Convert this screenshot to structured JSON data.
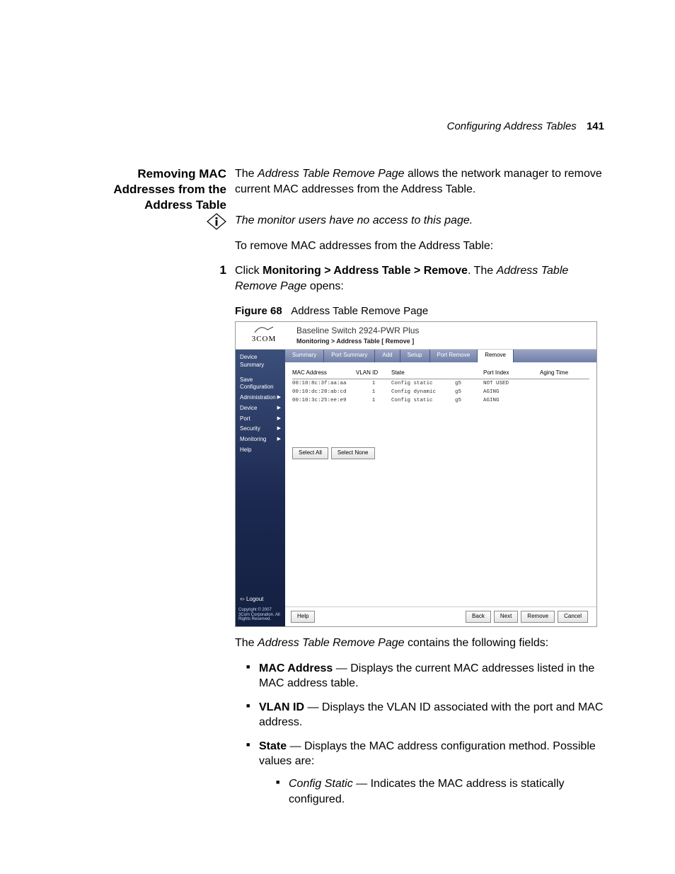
{
  "header": {
    "section": "Configuring Address Tables",
    "page_number": "141"
  },
  "sidehead": "Removing MAC Addresses from the Address Table",
  "intro": {
    "p1_a": "The ",
    "p1_em": "Address Table Remove Page",
    "p1_b": " allows the network manager to remove current MAC addresses from the Address Table.",
    "note": "The monitor users have no access to this page.",
    "p2": "To remove MAC addresses from the Address Table:"
  },
  "step1": {
    "num": "1",
    "a": "Click ",
    "b": "Monitoring > Address Table > Remove",
    "c": ". The ",
    "d": "Address Table Remove Page",
    "e": " opens:"
  },
  "figure": {
    "label": "Figure 68",
    "caption": "Address Table Remove Page"
  },
  "screenshot": {
    "brand": "3COM",
    "product": "Baseline Switch 2924-PWR Plus",
    "breadcrumb": "Monitoring > Address Table [ Remove ]",
    "tabs": [
      "Summary",
      "Port Summary",
      "Add",
      "Setup",
      "Port Remove",
      "Remove"
    ],
    "active_tab": 5,
    "nav": [
      "Device Summary",
      "Save Configuration",
      "Administration",
      "Device",
      "Port",
      "Security",
      "Monitoring",
      "Help"
    ],
    "nav_arrow_start_index": 2,
    "logout": "Logout",
    "copyright": "Copyright © 2007 3Com Corporation. All Rights Reserved.",
    "columns": [
      "MAC Address",
      "VLAN ID",
      "State",
      "",
      "Port Index",
      "Aging Time"
    ],
    "rows": [
      {
        "mac": "00:10:8c:3f:aa:aa",
        "vlan": "1",
        "state": "Config static",
        "q": "g5",
        "port": "NOT USED",
        "age": ""
      },
      {
        "mac": "00:10:dc:28:ab:cd",
        "vlan": "1",
        "state": "Config dynamic",
        "q": "g5",
        "port": "AGING",
        "age": ""
      },
      {
        "mac": "00:10:3c:25:ee:e9",
        "vlan": "1",
        "state": "Config static",
        "q": "g5",
        "port": "AGING",
        "age": ""
      }
    ],
    "sel_buttons": [
      "Select All",
      "Select None"
    ],
    "footer_left": [
      "Help"
    ],
    "footer_right": [
      "Back",
      "Next",
      "Remove",
      "Cancel"
    ]
  },
  "after_fig": {
    "p_a": "The ",
    "p_em": "Address Table Remove Page",
    "p_b": " contains the following fields:"
  },
  "fields": [
    {
      "name": "MAC Address",
      "desc": " — Displays the current MAC addresses listed in the MAC address table."
    },
    {
      "name": "VLAN ID",
      "desc": " — Displays the VLAN ID associated with the port and MAC address."
    },
    {
      "name": "State",
      "desc": " — Displays the MAC address configuration method. Possible values are:",
      "sub": [
        {
          "name": "Config Static",
          "desc": " — Indicates the MAC address is statically configured."
        }
      ]
    }
  ]
}
